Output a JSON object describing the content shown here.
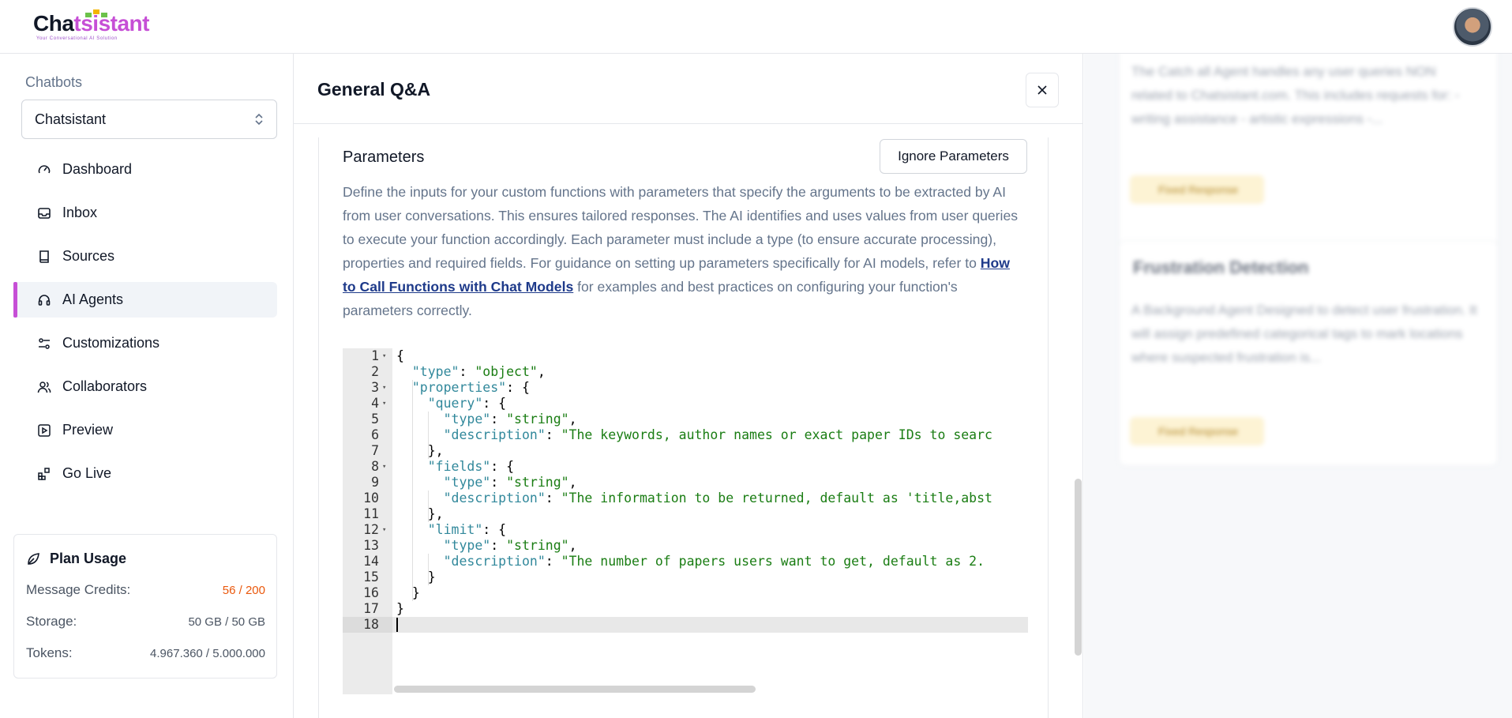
{
  "brand": {
    "logo_text_prefix": "Cha",
    "logo_text_mid": "t",
    "logo_text_suffix": "sistant",
    "tagline": "Your Conversational AI Solution",
    "accent_color": "#c64fd6"
  },
  "sidebar": {
    "heading": "Chatbots",
    "selected_bot": "Chatsistant",
    "items": [
      {
        "label": "Dashboard",
        "icon": "gauge-icon"
      },
      {
        "label": "Inbox",
        "icon": "inbox-icon"
      },
      {
        "label": "Sources",
        "icon": "book-icon"
      },
      {
        "label": "AI Agents",
        "icon": "headset-icon",
        "active": true
      },
      {
        "label": "Customizations",
        "icon": "sliders-icon"
      },
      {
        "label": "Collaborators",
        "icon": "users-icon"
      },
      {
        "label": "Preview",
        "icon": "play-square-icon"
      },
      {
        "label": "Go Live",
        "icon": "blocks-icon"
      }
    ],
    "plan": {
      "title": "Plan Usage",
      "rows": [
        {
          "label": "Message Credits:",
          "value": "56 / 200"
        },
        {
          "label": "Storage:",
          "value": "50 GB / 50 GB"
        },
        {
          "label": "Tokens:",
          "value": "4.967.360 / 5.000.000"
        }
      ]
    }
  },
  "modal": {
    "title": "General Q&A",
    "section_title": "Parameters",
    "ignore_button": "Ignore Parameters",
    "desc_before_link": "Define the inputs for your custom functions with parameters that specify the arguments to be extracted by AI from user conversations. This ensures tailored responses. The AI identifies and uses values from user queries to execute your function accordingly. Each parameter must include a type (to ensure accurate processing), properties and required fields. For guidance on setting up parameters specifically for AI models, refer to ",
    "desc_link": "How to Call Functions with Chat Models",
    "desc_after_link": " for examples and best practices on configuring your function's parameters correctly.",
    "code_lines": [
      "{",
      "  \"type\": \"object\",",
      "  \"properties\": {",
      "    \"query\": {",
      "      \"type\": \"string\",",
      "      \"description\": \"The keywords, author names or exact paper IDs to searc",
      "    },",
      "    \"fields\": {",
      "      \"type\": \"string\",",
      "      \"description\": \"The information to be returned, default as 'title,abst",
      "    },",
      "    \"limit\": {",
      "      \"type\": \"string\",",
      "      \"description\": \"The number of papers users want to get, default as 2. ",
      "    }",
      "  }",
      "}",
      ""
    ],
    "fold_lines": [
      1,
      3,
      4,
      8,
      12
    ]
  },
  "background": {
    "card1_text": "The Catch all Agent handles any user queries NON related to Chatsistant.com. This includes requests for: - writing assistance - artistic expressions -...",
    "card1_badge": "Fixed Response",
    "card2_title": "Frustration Detection",
    "card2_text": "A Background Agent Designed to detect user frustration. It will assign predefined categorical tags to mark locations where suspected frustration is...",
    "card2_badge": "Fixed Response"
  }
}
